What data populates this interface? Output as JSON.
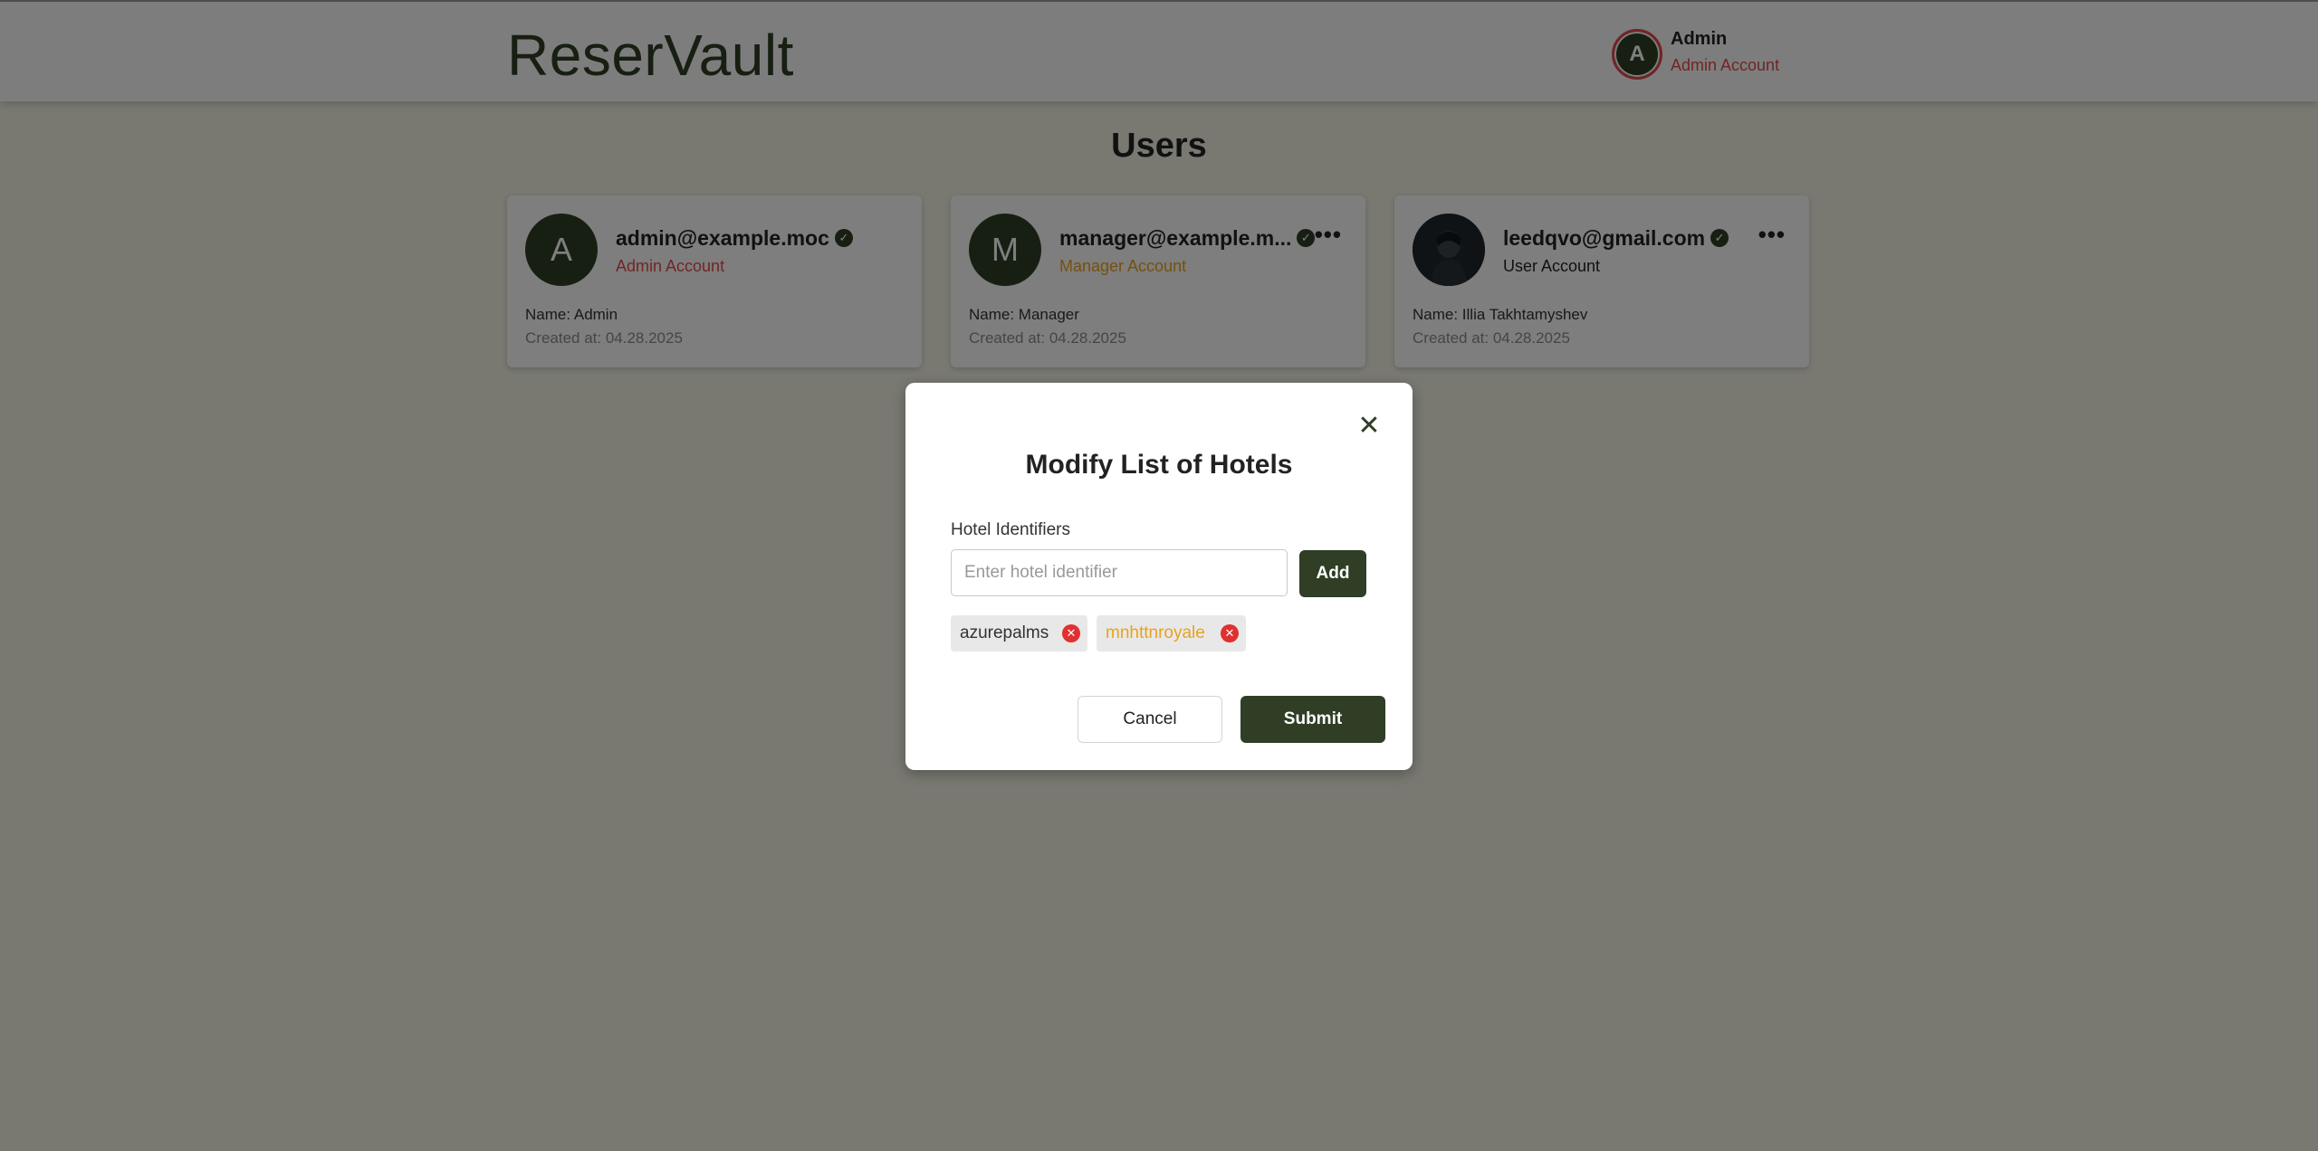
{
  "app": {
    "title": "ReserVault"
  },
  "current_user": {
    "initial": "A",
    "name": "Admin",
    "role": "Admin Account"
  },
  "page": {
    "title": "Users"
  },
  "users": [
    {
      "initial": "A",
      "email": "admin@example.moc",
      "role": "Admin Account",
      "name": "Name: Admin",
      "created": "Created at: 04.28.2025"
    },
    {
      "initial": "M",
      "email": "manager@example.m...",
      "role": "Manager Account",
      "name": "Name: Manager",
      "created": "Created at: 04.28.2025"
    },
    {
      "initial": "",
      "email": "leedqvo@gmail.com",
      "role": "User Account",
      "name": "Name: Illia Takhtamyshev",
      "created": "Created at: 04.28.2025"
    }
  ],
  "icons": {
    "verified": "verified-check-icon",
    "more": "more-horizontal-icon",
    "close": "close-icon",
    "remove": "remove-chip-icon"
  },
  "modal": {
    "title": "Modify List of Hotels",
    "field_label": "Hotel Identifiers",
    "input_placeholder": "Enter hotel identifier",
    "input_value": "",
    "add_label": "Add",
    "hotels": [
      "azurepalms",
      "mnhttnroyale"
    ],
    "cancel_label": "Cancel",
    "submit_label": "Submit"
  },
  "colors": {
    "brand": "#2f3e25",
    "admin_role": "#e34b4b",
    "manager_role": "#e8a31b",
    "remove": "#e03030"
  }
}
